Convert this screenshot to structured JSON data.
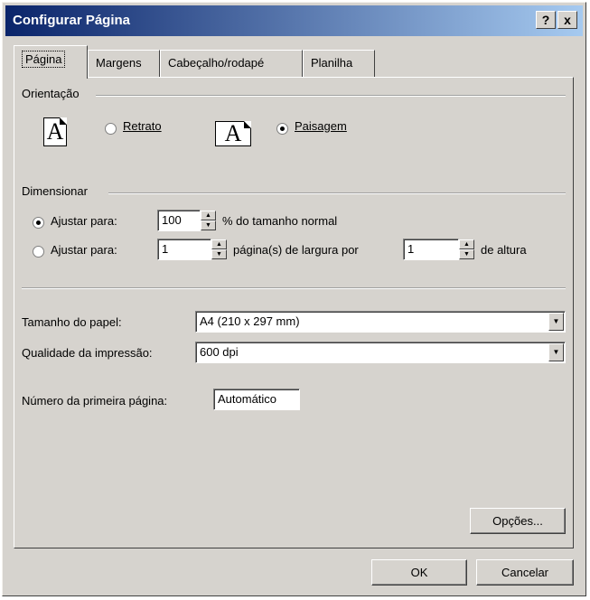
{
  "window": {
    "title": "Configurar Página",
    "help_label": "?",
    "close_label": "x"
  },
  "tabs": [
    {
      "label": "Página",
      "active": true
    },
    {
      "label": "Margens"
    },
    {
      "label": "Cabeçalho/rodapé"
    },
    {
      "label": "Planilha"
    }
  ],
  "orientation": {
    "title": "Orientação",
    "portrait_label": "Retrato",
    "landscape_label": "Paisagem",
    "icon_letter": "A",
    "selected": "Paisagem"
  },
  "scaling": {
    "title": "Dimensionar",
    "adjust_label": "Ajustar para:",
    "adjust_value": "100",
    "adjust_suffix": "% do tamanho normal",
    "fit_label": "Ajustar para:",
    "fit_pages_wide": "1",
    "fit_middle": "página(s) de largura por",
    "fit_pages_tall": "1",
    "fit_suffix": "de altura"
  },
  "paper": {
    "size_label": "Tamanho do papel:",
    "size_value": "A4 (210 x 297 mm)",
    "quality_label": "Qualidade da impressão:",
    "quality_value": "600 dpi",
    "first_page_label": "Número da primeira página:",
    "first_page_value": "Automático"
  },
  "buttons": {
    "options": "Opções...",
    "ok": "OK",
    "cancel": "Cancelar"
  },
  "icons": {
    "spin_up": "▲",
    "spin_down": "▼",
    "dropdown": "▼"
  }
}
